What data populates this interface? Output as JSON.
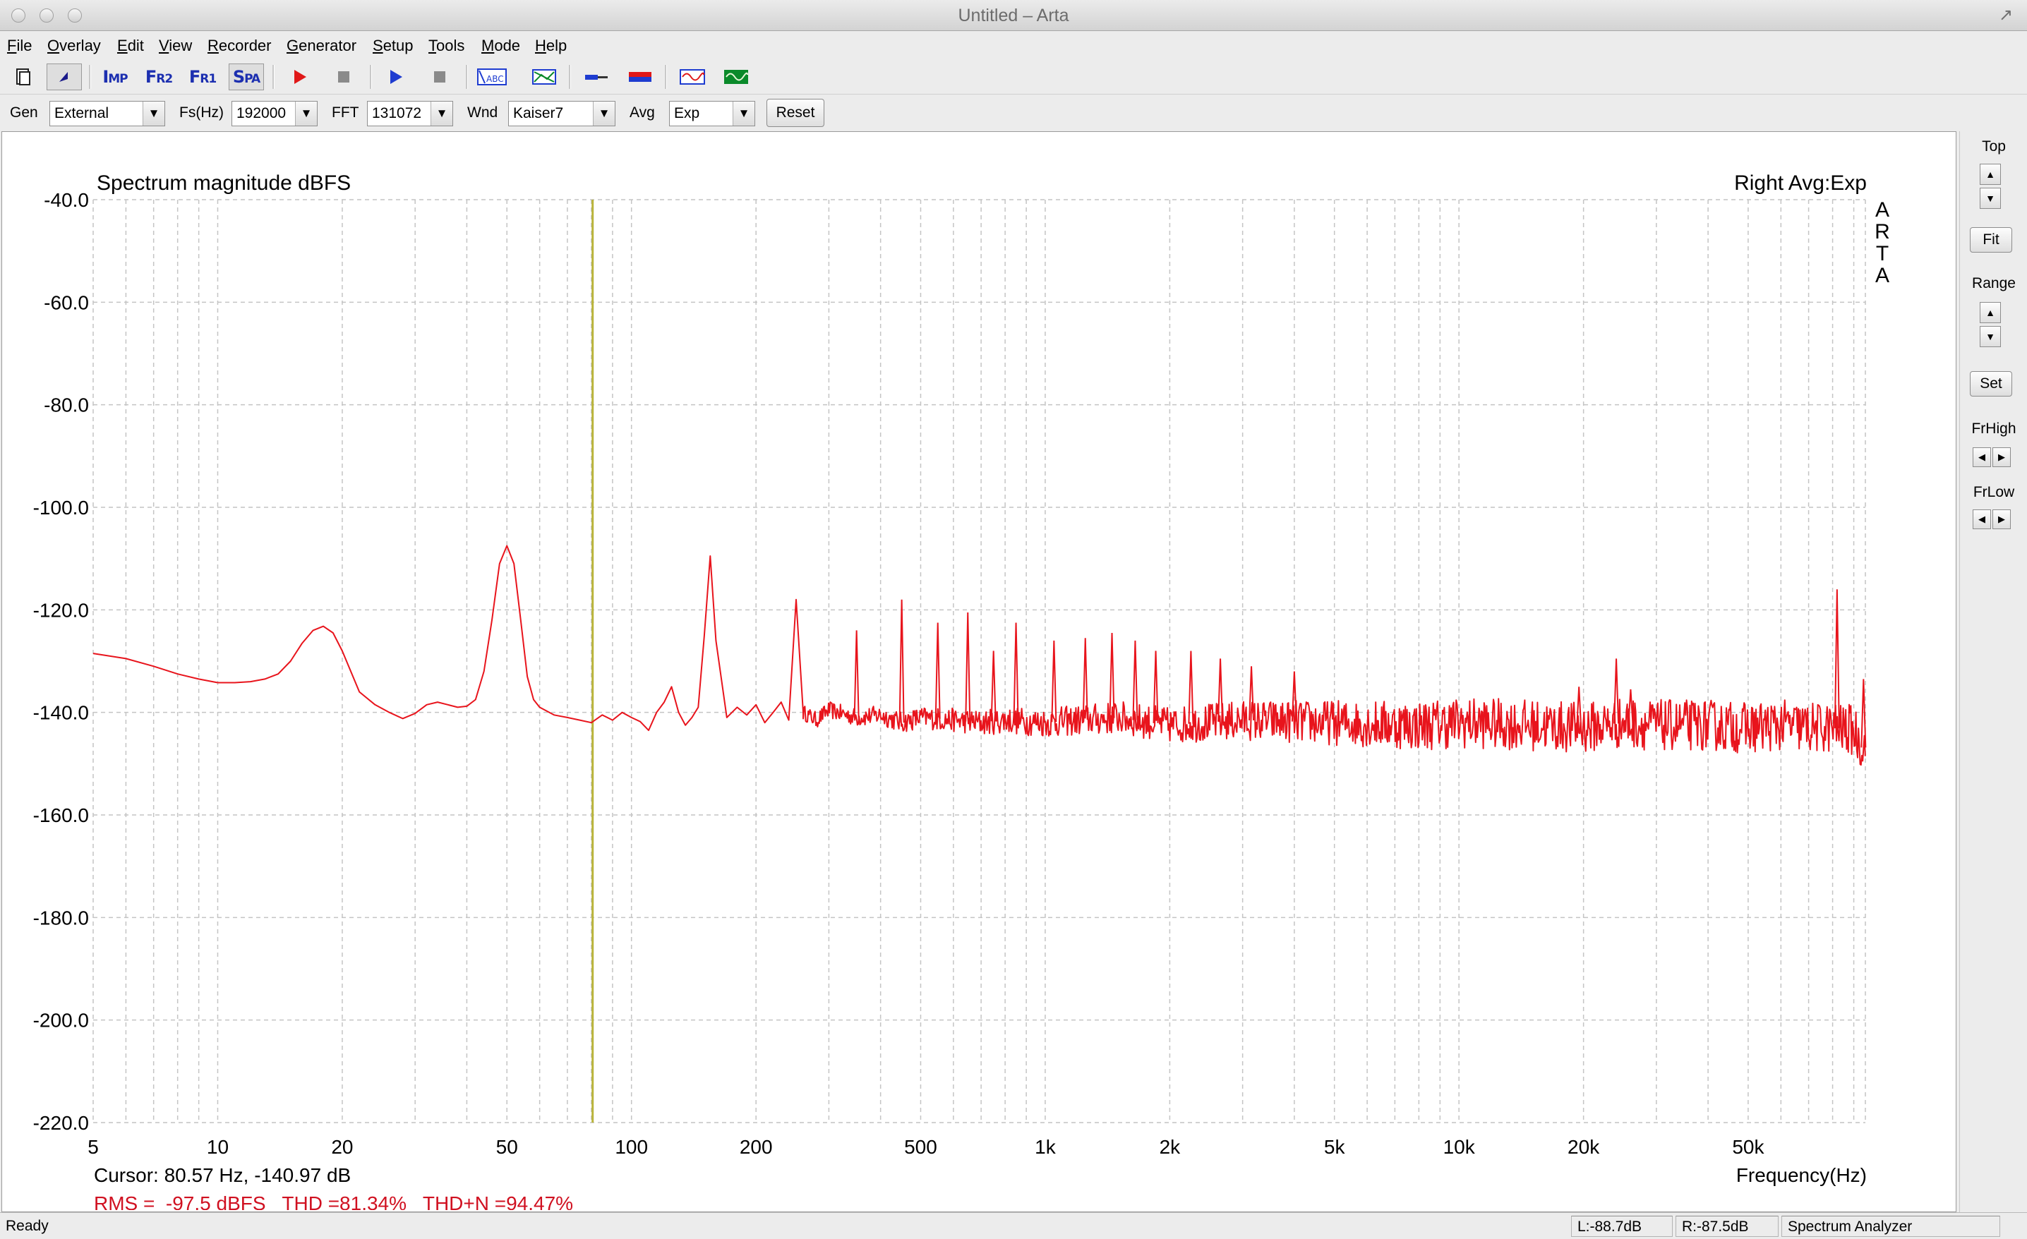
{
  "window": {
    "title": "Untitled – Arta"
  },
  "menu": [
    {
      "label": "File",
      "mnemonic": "F",
      "rest": "ile"
    },
    {
      "label": "Overlay",
      "mnemonic": "O",
      "rest": "verlay"
    },
    {
      "label": "Edit",
      "mnemonic": "E",
      "rest": "dit"
    },
    {
      "label": "View",
      "mnemonic": "V",
      "rest": "iew"
    },
    {
      "label": "Recorder",
      "mnemonic": "R",
      "rest": "ecorder"
    },
    {
      "label": "Generator",
      "mnemonic": "G",
      "rest": "enerator"
    },
    {
      "label": "Setup",
      "mnemonic": "S",
      "rest": "etup"
    },
    {
      "label": "Tools",
      "mnemonic": "T",
      "rest": "ools"
    },
    {
      "label": "Mode",
      "mnemonic": "M",
      "rest": "ode"
    },
    {
      "label": "Help",
      "mnemonic": "H",
      "rest": "elp"
    }
  ],
  "toolbar": {
    "imp": {
      "big": "I",
      "small": "MP"
    },
    "fr2": {
      "big": "F",
      "small": "R2"
    },
    "fr1": {
      "big": "F",
      "small": "R1"
    },
    "spa": {
      "big": "S",
      "small": "PA"
    }
  },
  "controls": {
    "gen_label": "Gen",
    "gen_value": "External",
    "fs_label": "Fs(Hz)",
    "fs_value": "192000",
    "fft_label": "FFT",
    "fft_value": "131072",
    "wnd_label": "Wnd",
    "wnd_value": "Kaiser7",
    "avg_label": "Avg",
    "avg_value": "Exp",
    "reset_label": "Reset"
  },
  "side_panel": {
    "top_label": "Top",
    "fit_label": "Fit",
    "range_label": "Range",
    "set_label": "Set",
    "frhigh_label": "FrHigh",
    "frlow_label": "FrLow"
  },
  "status": {
    "ready": "Ready",
    "left_level": "L:-88.7dB",
    "right_level": "R:-87.5dB",
    "mode": "Spectrum Analyzer"
  },
  "colors": {
    "trace": "#e8141c",
    "cursor": "#b9b43a",
    "grid": "#c4c4c4",
    "readout": "#d01020"
  },
  "chart_data": {
    "type": "line",
    "title": "Spectrum magnitude dBFS",
    "channel_label": "Right Avg:Exp",
    "logo": "ARTA",
    "xlabel": "Frequency(Hz)",
    "ylabel": "",
    "x_scale": "log",
    "xlim": [
      5,
      96000
    ],
    "ylim": [
      -220,
      -40
    ],
    "y_ticks": [
      -40,
      -60,
      -80,
      -100,
      -120,
      -140,
      -160,
      -180,
      -200,
      -220
    ],
    "y_tick_labels": [
      "-40.0",
      "-60.0",
      "-80.0",
      "-100.0",
      "-120.0",
      "-140.0",
      "-160.0",
      "-180.0",
      "-200.0",
      "-220.0"
    ],
    "x_ticks": [
      5,
      10,
      20,
      50,
      100,
      200,
      500,
      1000,
      2000,
      5000,
      10000,
      20000,
      50000
    ],
    "x_tick_labels": [
      "5",
      "10",
      "20",
      "50",
      "100",
      "200",
      "500",
      "1k",
      "2k",
      "5k",
      "10k",
      "20k",
      "50k"
    ],
    "grid": true,
    "cursor": {
      "freq": 80.57,
      "level": -140.97,
      "text": "Cursor: 80.57 Hz, -140.97 dB"
    },
    "readout": "RMS =  -97.5 dBFS   THD =81.34%   THD+N =94.47%",
    "series": [
      {
        "x": [
          5,
          6,
          7,
          8,
          9,
          10,
          11,
          12,
          13,
          14,
          15,
          16,
          17,
          18,
          19,
          20,
          22,
          24,
          26,
          28,
          30,
          32,
          34,
          36,
          38,
          40,
          42,
          44,
          46,
          48,
          50,
          52,
          54,
          56,
          58,
          60,
          65,
          70,
          75,
          80,
          85,
          90,
          95,
          100,
          105,
          110,
          115,
          120,
          125,
          130,
          135,
          140,
          145,
          150,
          155,
          160,
          170,
          180,
          190,
          200,
          210,
          220,
          230,
          240,
          250,
          260,
          280,
          300,
          350,
          400,
          450,
          500,
          600,
          700,
          800,
          1000,
          1500,
          2000,
          3000,
          5000,
          8000,
          10000,
          15000,
          20000,
          25000,
          30000,
          40000,
          50000,
          60000,
          70000,
          80000,
          90000,
          96000
        ],
        "y": [
          -128.5,
          -129.5,
          -131,
          -132.5,
          -133.5,
          -134.2,
          -134.2,
          -134.0,
          -133.5,
          -132.5,
          -130.0,
          -126.5,
          -124.0,
          -123.2,
          -124.5,
          -128.0,
          -136.0,
          -138.5,
          -140.0,
          -141.2,
          -140.2,
          -138.5,
          -138.0,
          -138.5,
          -139.0,
          -138.8,
          -137.5,
          -132.0,
          -122.0,
          -111.0,
          -107.5,
          -111.0,
          -122.0,
          -133.0,
          -137.5,
          -139.0,
          -140.5,
          -141.0,
          -141.5,
          -142.0,
          -140.5,
          -141.5,
          -140.0,
          -141.0,
          -141.8,
          -143.5,
          -140.0,
          -138.0,
          -135.0,
          -140.0,
          -142.5,
          -141.0,
          -139.0,
          -125.0,
          -109.5,
          -126.0,
          -141.0,
          -139.0,
          -140.5,
          -138.5,
          -142.0,
          -140.0,
          -138.0,
          -141.5,
          -118.0,
          -140.0,
          -141.5,
          -139.5,
          -141.0,
          -140.5,
          -142.0,
          -141.0,
          -141.5,
          -142.0,
          -141.5,
          -142.0,
          -141.0,
          -142.5,
          -141.5,
          -142.0,
          -142.5,
          -142.0,
          -142.5,
          -143.0,
          -142.0,
          -142.5,
          -142.5,
          -143.0,
          -142.5,
          -143.0,
          -143.0,
          -143.5,
          -147.5
        ]
      }
    ],
    "spurs": [
      {
        "freq": 350,
        "level": -124.0
      },
      {
        "freq": 450,
        "level": -118.0
      },
      {
        "freq": 550,
        "level": -122.5
      },
      {
        "freq": 650,
        "level": -120.5
      },
      {
        "freq": 750,
        "level": -128.0
      },
      {
        "freq": 850,
        "level": -122.5
      },
      {
        "freq": 1050,
        "level": -126.0
      },
      {
        "freq": 1250,
        "level": -125.5
      },
      {
        "freq": 1450,
        "level": -124.5
      },
      {
        "freq": 1650,
        "level": -126.0
      },
      {
        "freq": 1850,
        "level": -128.0
      },
      {
        "freq": 2250,
        "level": -128.0
      },
      {
        "freq": 2650,
        "level": -129.5
      },
      {
        "freq": 3150,
        "level": -131.0
      },
      {
        "freq": 4000,
        "level": -132.0
      },
      {
        "freq": 19500,
        "level": -135.0
      },
      {
        "freq": 24000,
        "level": -129.5
      },
      {
        "freq": 26000,
        "level": -135.5
      },
      {
        "freq": 82000,
        "level": -116.0
      },
      {
        "freq": 95000,
        "level": -133.5
      }
    ]
  }
}
